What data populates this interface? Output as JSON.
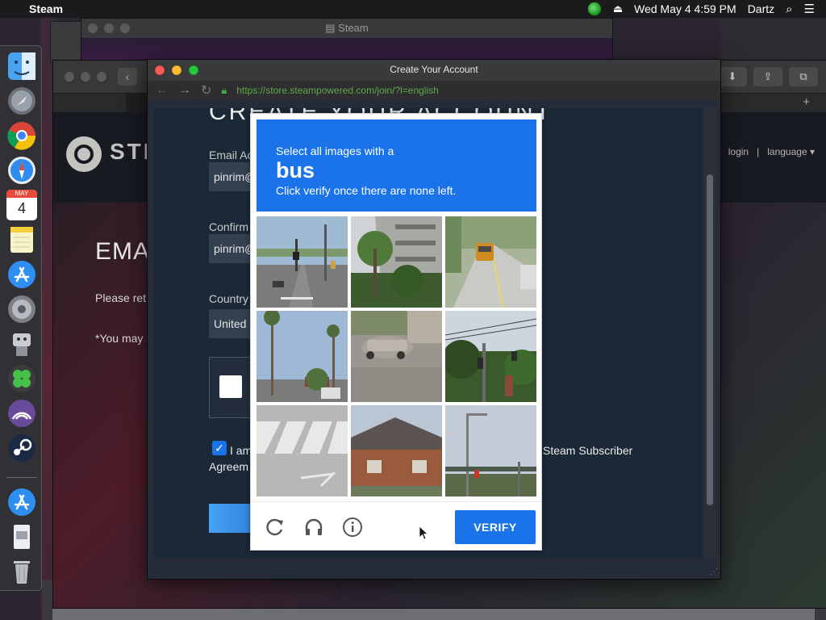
{
  "menubar": {
    "app_name": "Steam",
    "clock": "Wed May 4  4:59 PM",
    "user": "Dartz"
  },
  "back_window": {
    "title": "Steam"
  },
  "store": {
    "nav_login": "login",
    "nav_separator": "|",
    "nav_language": "language",
    "brand_partial": "STE",
    "heading_partial": "EMA",
    "text1_partial": "Please ret",
    "text2_partial": "*You may"
  },
  "window": {
    "title": "Create Your Account",
    "url": "https://store.steampowered.com/join/?l=english"
  },
  "form": {
    "heading": "CREATE YOUR ACCOUNT",
    "email_label": "Email Ac",
    "email_value": "pinrim@",
    "confirm_label": "Confirm",
    "confirm_value": "pinrim@",
    "country_label": "Country",
    "country_value": "United",
    "agree_part1": "I am",
    "agree_part2": "Agreem",
    "agree_right": "Steam Subscriber",
    "agree_checked": true
  },
  "captcha": {
    "prompt_line1": "Select all images with a",
    "target": "bus",
    "prompt_line3": "Click verify once there are none left.",
    "verify_label": "VERIFY",
    "tiles": [
      {
        "subject": "road-intersection-traffic-light"
      },
      {
        "subject": "palm-trees-building"
      },
      {
        "subject": "road-with-yellow-bus"
      },
      {
        "subject": "palm-trees-street"
      },
      {
        "subject": "parked-car"
      },
      {
        "subject": "traffic-lights-street"
      },
      {
        "subject": "crosswalk"
      },
      {
        "subject": "brick-building"
      },
      {
        "subject": "streetlight-traffic-signal"
      }
    ]
  },
  "dock": {
    "apps": [
      "Finder",
      "Launchpad",
      "Chrome",
      "Safari",
      "Calendar",
      "Notes",
      "App Store",
      "System Preferences",
      "Automator",
      "Clover",
      "Transmission",
      "Steam",
      "App Store",
      "Document",
      "Trash"
    ],
    "calendar_month": "MAY",
    "calendar_day": "4"
  },
  "colors": {
    "accent": "#1a73e8",
    "steam_bg": "#1b2838",
    "url_green": "#5fa84a"
  }
}
